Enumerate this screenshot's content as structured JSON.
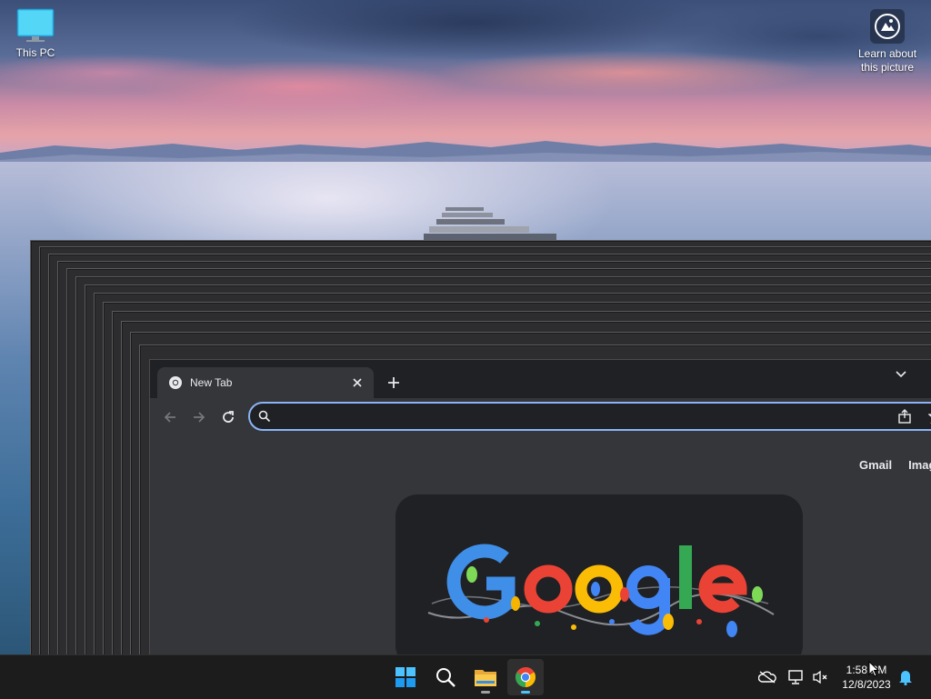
{
  "desktop": {
    "icons": [
      {
        "label": "This PC",
        "icon": "monitor-icon"
      },
      {
        "label": "Learn about this picture",
        "icon": "camera-spotlight-icon"
      }
    ]
  },
  "browser": {
    "tab": {
      "title": "New Tab",
      "favicon": "chrome-icon"
    },
    "omnibox": {
      "value": "",
      "placeholder": ""
    },
    "toolbar": {
      "back": "arrow-left-icon",
      "forward": "arrow-right-icon",
      "reload": "reload-icon"
    },
    "page": {
      "top_links": [
        "Gmail",
        "Images"
      ],
      "logo": "Google"
    }
  },
  "taskbar": {
    "apps": [
      "windows-start-icon",
      "search-icon",
      "file-explorer-icon",
      "chrome-icon"
    ],
    "tray": {
      "icons": [
        "onedrive-offline-icon",
        "network-icon",
        "volume-muted-icon",
        "notification-bell-icon"
      ],
      "time": "1:58 PM",
      "date": "12/8/2023"
    }
  },
  "colors": {
    "accent": "#8ab4f8",
    "taskbar_bg": "#1c1c1c",
    "browser_frame": "#202124",
    "browser_toolbar": "#35363a"
  }
}
